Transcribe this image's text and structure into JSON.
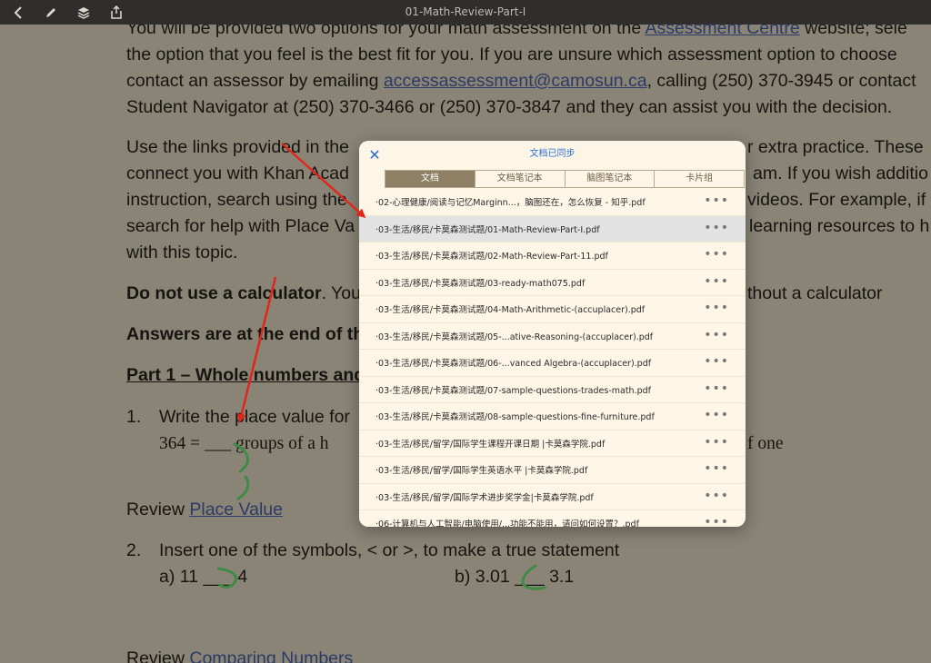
{
  "toolbar": {
    "title": "01-Math-Review-Part-I",
    "icons": [
      "chevron-left-icon",
      "pencil-icon",
      "layers-icon",
      "share-icon"
    ]
  },
  "doc": {
    "line1_pre": "You will be provided two options for your math assessment on the ",
    "line1_link": "Assessment Centre",
    "line1_post": " website; sele",
    "line2": "the option that you feel is the best fit for you. If you are unsure which assessment option to choose",
    "line3_pre": "contact an assessor by emailing ",
    "line3_link": "accessassessment@camosun.ca",
    "line3_post": ", calling (250) 370-3945 or contact",
    "line4": "Student Navigator at (250) 370-3466 or (250) 370-3847 and they can assist you with the decision.",
    "line5_left": "Use the links provided in the",
    "line5_right": "r extra practice. These",
    "line6_left": "connect you with Khan Acad",
    "line6_right": "am. If you wish additio",
    "line7_left": "instruction, search using the",
    "line7_right": "videos.  For example, if",
    "line8_left": "search for help with Place Va",
    "line8_right": "learning resources to h",
    "line9": "with this topic.",
    "line10_bold": "Do not use a calculator",
    "line10_left_rest": ". You",
    "line10_right": "thout a calculator",
    "line11_bold": "Answers are at the end of th",
    "line12_bold": "Part 1 – Whole numbers and",
    "q1_num": "1.",
    "q1_text": "Write the place value for",
    "q1_eq_left": "364 =  ___ groups of a h",
    "q1_eq_right": "f one",
    "review1_pre": "Review ",
    "review1_link": "Place Value",
    "q2_num": "2.",
    "q2_text": "Insert one of the symbols, < or >, to make a true statement",
    "q2_a": "a)    11 ___ 4",
    "q2_b": "b) 3.01 ___ 3.1",
    "review2_pre": "Review ",
    "review2_link": "Comparing Numbers"
  },
  "modal": {
    "close_icon": "close-icon",
    "title": "文档已同步",
    "tabs": [
      "文档",
      "文档笔记本",
      "脑图笔记本",
      "卡片组"
    ],
    "active_tab": 0,
    "more_label": "•••",
    "items": [
      "·02-心理健康/阅读与记忆Marginn...，脑图还在，怎么恢复 - 知乎.pdf",
      "·03-生活/移民/卡莫森测试题/01-Math-Review-Part-I.pdf",
      "·03-生活/移民/卡莫森测试题/02-Math-Review-Part-11.pdf",
      "·03-生活/移民/卡莫森测试题/03-ready-math075.pdf",
      "·03-生活/移民/卡莫森测试题/04-Math-Arithmetic-(accuplacer).pdf",
      "·03-生活/移民/卡莫森测试题/05-...ative-Reasoning-(accuplacer).pdf",
      "·03-生活/移民/卡莫森测试题/06-...vanced Algebra-(accuplacer).pdf",
      "·03-生活/移民/卡莫森测试题/07-sample-questions-trades-math.pdf",
      "·03-生活/移民/卡莫森测试题/08-sample-questions-fine-furniture.pdf",
      "·03-生活/移民/留学/国际学生课程开课日期 |卡莫森学院.pdf",
      "·03-生活/移民/留学/国际学生英语水平 |卡莫森学院.pdf",
      "·03-生活/移民/留学/国际学术进步奖学金|卡莫森学院.pdf",
      "·06-计算机与人工智能/电脑使用/...功能不能用，请问如何设置？.pdf"
    ],
    "selected_index": 1
  },
  "colors": {
    "accent": "#2b6fd6",
    "annotation_arrow": "#e0261b",
    "ink_green": "#3f8a45",
    "dim_overlay": "#8a8477"
  }
}
